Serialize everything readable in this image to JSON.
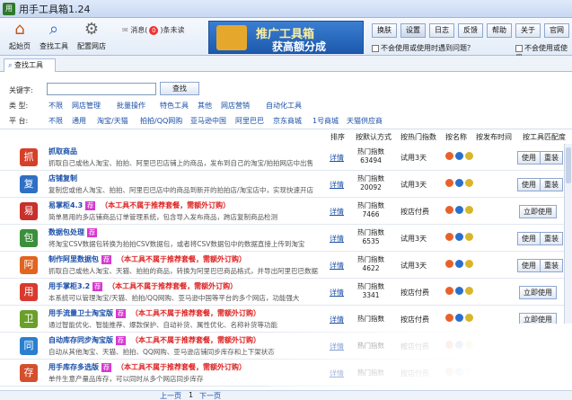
{
  "window": {
    "title": "用手工具箱1.24"
  },
  "toolbar": {
    "home_label": "起始页",
    "find_label": "查找工具",
    "config_label": "配置网店",
    "messages_label": "消息(",
    "messages_count": "0",
    "messages_suffix": ")条未读",
    "banner_line1": "推广工具箱",
    "banner_line2": "获高额分成",
    "buttons": [
      "换肤",
      "设置",
      "日志",
      "反馈",
      "帮助",
      "关于",
      "官网"
    ],
    "check1": "不会使用或使用时遇到问题？",
    "check2": "不会使用或使用"
  },
  "tab": {
    "label": "查找工具"
  },
  "filter": {
    "keyword_label": "关键字:",
    "search_button": "查找",
    "type_label": "类    型:",
    "types": [
      "不限",
      "网店管理",
      "批量操作",
      "特色工具",
      "其他",
      "网店营销",
      "自动化工具"
    ],
    "platform_label": "平    台:",
    "platforms": [
      "不限",
      "通用",
      "淘宝/天猫",
      "拍拍/QQ网购",
      "亚马逊中国",
      "阿里巴巴",
      "京东商城",
      "1号商城",
      "天猫供应商"
    ]
  },
  "list_header": {
    "sort": "排序",
    "by_pay": "按默认方式",
    "by_hot": "按热门指数",
    "by_name": "按名称",
    "by_time": "按发布时间",
    "by_match": "按工具匹配度"
  },
  "rows": [
    {
      "name": "抓取商品",
      "tag": "",
      "note": "",
      "desc": "抓取自己或他人淘宝、拍拍、阿里巴巴店铺上的商品，发布到自己的淘宝/拍拍网店中出售",
      "detail": "详情",
      "hot_label": "热门指数",
      "hot_value": "63494",
      "trial": "试用3天",
      "buttons": [
        "使用",
        "重装"
      ],
      "color": "#d6402b",
      "glyph": "抓"
    },
    {
      "name": "店铺复制",
      "tag": "",
      "note": "",
      "desc": "复制您或他人淘宝、拍拍、阿里巴巴店中的商品到新开的拍拍店/淘宝店中，实现快速开店",
      "detail": "详情",
      "hot_label": "热门指数",
      "hot_value": "20092",
      "trial": "试用3天",
      "buttons": [
        "使用",
        "重装"
      ],
      "color": "#2f6fc4",
      "glyph": "复"
    },
    {
      "name": "易掌柜4.3",
      "tag": "荐",
      "note": "（本工具不属于推荐套餐，需额外订购）",
      "desc": "简单易用的多店铺商品订单管理系统，包含导入发布商品，跨店复制商品检测",
      "detail": "详情",
      "hot_label": "热门指数",
      "hot_value": "7466",
      "trial": "按店付费",
      "buttons": [
        "立即使用"
      ],
      "color": "#c8302b",
      "glyph": "易"
    },
    {
      "name": "数据包处理",
      "tag": "荐",
      "note": "",
      "desc": "将淘宝CSV数据包转换为拍拍CSV数据包，或者将CSV数据包中的数据直接上传到淘宝",
      "detail": "详情",
      "hot_label": "热门指数",
      "hot_value": "6535",
      "trial": "试用3天",
      "buttons": [
        "使用",
        "重装"
      ],
      "color": "#3c8f3c",
      "glyph": "包"
    },
    {
      "name": "制作阿里数据包",
      "tag": "荐",
      "note": "（本工具不属于推荐套餐，需额外订购）",
      "desc": "抓取自己或他人淘宝、天猫、拍拍的商品，转换为阿里巴巴商品格式，并导出阿里巴巴数据包",
      "detail": "详情",
      "hot_label": "热门指数",
      "hot_value": "4622",
      "trial": "试用3天",
      "buttons": [
        "使用",
        "重装"
      ],
      "color": "#e2641f",
      "glyph": "阿"
    },
    {
      "name": "用手掌柜3.2",
      "tag": "荐",
      "note": "（本工具不属于推荐套餐，需额外订购）",
      "desc": "本系统可以管理淘宝/天猫、拍拍/QQ网购、亚马逊中国等平台的多个网店，功能强大",
      "detail": "详情",
      "hot_label": "热门指数",
      "hot_value": "3341",
      "trial": "按店付费",
      "buttons": [
        "立即使用"
      ],
      "color": "#d83b2e",
      "glyph": "用"
    },
    {
      "name": "用手流量卫士淘宝版",
      "tag": "荐",
      "note": "（本工具不属于推荐套餐，需额外订购）",
      "desc": "通过智能优化、智能推荐、爆款保护、自动补货、属性优化、名称补货等功能",
      "detail": "详情",
      "hot_label": "热门指数",
      "hot_value": "",
      "trial": "按店付费",
      "buttons": [
        "立即使用"
      ],
      "color": "#6a9f2a",
      "glyph": "卫"
    },
    {
      "name": "自动库存同步淘宝版",
      "tag": "荐",
      "note": "（本工具不属于推荐套餐，需额外订购）",
      "desc": "自动从其他淘宝、天猫、拍拍、QQ网购、亚马逊店铺同步库存和上下架状态",
      "detail": "详情",
      "hot_label": "热门指数",
      "hot_value": "",
      "trial": "按店付费",
      "buttons": [
        "立即使用"
      ],
      "color": "#2a7fcf",
      "glyph": "同"
    },
    {
      "name": "用手库存多选版",
      "tag": "荐",
      "note": "（本工具不属于推荐套餐，需额外订购）",
      "desc": "单件生意产量品库存，可以同时从多个网店同步库存",
      "detail": "详情",
      "hot_label": "热门指数",
      "hot_value": "",
      "trial": "按店付费",
      "buttons": [
        "立即使用"
      ],
      "color": "#d4502c",
      "glyph": "存"
    }
  ],
  "pager": {
    "prev": "上一页",
    "page": "1",
    "next": "下一页"
  }
}
